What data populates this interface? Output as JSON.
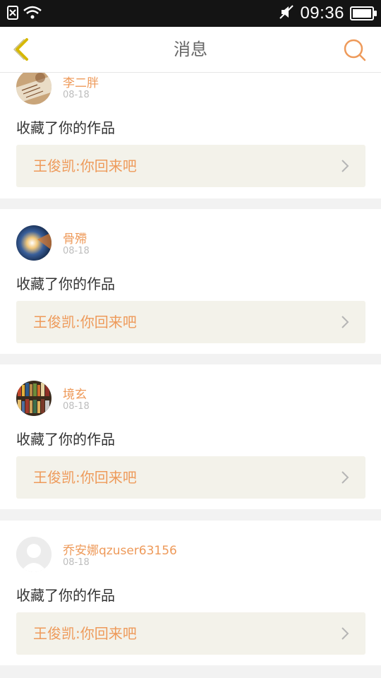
{
  "status_bar": {
    "time": "09:36"
  },
  "header": {
    "title": "消息"
  },
  "notifications": [
    {
      "user": "李二胖",
      "date": "08-18",
      "action": "收藏了你的作品",
      "target": "王俊凯:你回来吧"
    },
    {
      "user": "骨殢",
      "date": "08-18",
      "action": "收藏了你的作品",
      "target": "王俊凯:你回来吧"
    },
    {
      "user": "境玄",
      "date": "08-18",
      "action": "收藏了你的作品",
      "target": "王俊凯:你回来吧"
    },
    {
      "user": "乔安娜qzuser63156",
      "date": "08-18",
      "action": "收藏了你的作品",
      "target": "王俊凯:你回来吧"
    }
  ],
  "colors": {
    "accent": "#ee9a5a",
    "back_icon": "#d6b800",
    "card_target_bg": "#f3f2ea"
  }
}
